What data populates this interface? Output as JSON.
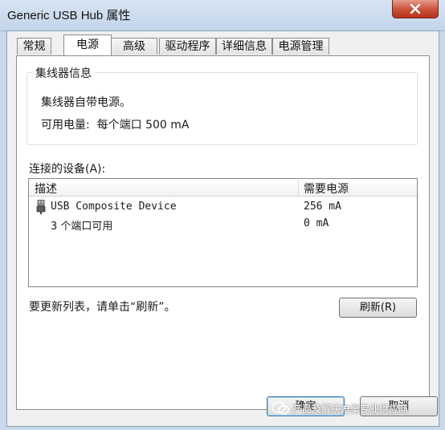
{
  "window": {
    "title": "Generic USB Hub 属性"
  },
  "tabs": [
    {
      "label": "常规"
    },
    {
      "label": "电源"
    },
    {
      "label": "高级"
    },
    {
      "label": "驱动程序"
    },
    {
      "label": "详细信息"
    },
    {
      "label": "电源管理"
    }
  ],
  "hub_info": {
    "title": "集线器信息",
    "line1": "集线器自带电源。",
    "line2": "可用电量:  每个端口 500 mA"
  },
  "devices": {
    "label": "连接的设备(A):",
    "columns": [
      "描述",
      "需要电源"
    ],
    "rows": [
      {
        "name": "USB Composite Device",
        "power": "256 mA",
        "icon": "usb-plug-icon"
      },
      {
        "name": "3 个端口可用",
        "power": "0 mA"
      }
    ]
  },
  "hint": "要更新列表，请单击“刷新”。",
  "buttons": {
    "refresh": "刷新(R)",
    "ok": "确定",
    "cancel": "取消"
  },
  "watermark": {
    "text": "产品及解决方案专业供应商"
  },
  "colors": {
    "close": "#c9503a",
    "accent": "#3c7fb1"
  }
}
